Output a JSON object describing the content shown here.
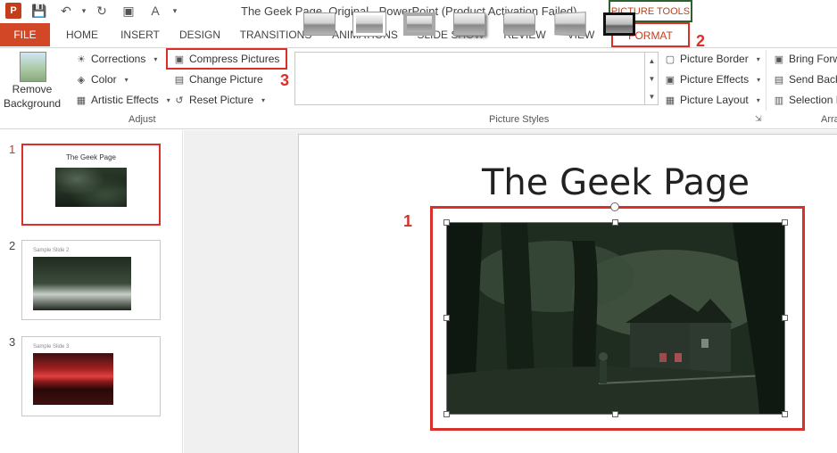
{
  "window": {
    "title": "The Geek Page_Original - PowerPoint (Product Activation Failed)",
    "contextual_tab_group": "PICTURE TOOLS"
  },
  "tabs": [
    "FILE",
    "HOME",
    "INSERT",
    "DESIGN",
    "TRANSITIONS",
    "ANIMATIONS",
    "SLIDE SHOW",
    "REVIEW",
    "VIEW",
    "FORMAT"
  ],
  "ribbon": {
    "adjust": {
      "remove_background_line1": "Remove",
      "remove_background_line2": "Background",
      "corrections": "Corrections",
      "color": "Color",
      "artistic_effects": "Artistic Effects",
      "compress_pictures": "Compress Pictures",
      "change_picture": "Change Picture",
      "reset_picture": "Reset Picture",
      "group_label": "Adjust"
    },
    "picture_styles": {
      "group_label": "Picture Styles",
      "picture_border": "Picture Border",
      "picture_effects": "Picture Effects",
      "picture_layout": "Picture Layout"
    },
    "arrange": {
      "bring_forward": "Bring Forw",
      "send_backward": "Send Back",
      "selection_pane": "Selection P",
      "group_label": "Arra"
    }
  },
  "annotations": {
    "one_slide": "1",
    "one_pic": "1",
    "two": "2",
    "three": "3"
  },
  "slides": [
    {
      "number": "1",
      "title": "The Geek Page"
    },
    {
      "number": "2",
      "title": "Sample Slide 2"
    },
    {
      "number": "3",
      "title": "Sample Slide 3"
    }
  ],
  "main_slide": {
    "title": "The Geek Page"
  },
  "colors": {
    "accent_red": "#d9302a",
    "file_tab": "#d24726",
    "picture_tools_border": "#2e5f2e"
  }
}
